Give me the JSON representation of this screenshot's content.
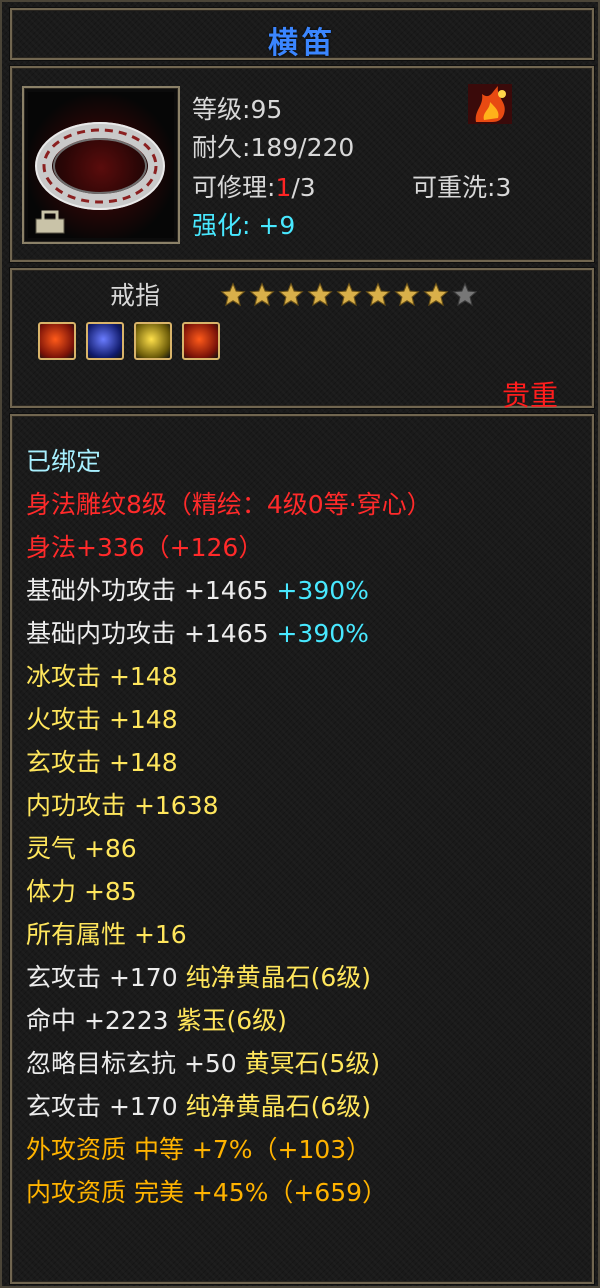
{
  "item": {
    "name": "横笛",
    "level_label": "等级:",
    "level": "95",
    "durability_label": "耐久:",
    "durability": "189/220",
    "repair_label": "可修理:",
    "repair_used": "1",
    "repair_total": "/3",
    "rewash_label": "可重洗:",
    "rewash": "3",
    "enhance_label": "强化:",
    "enhance": " +9",
    "type": "戒指",
    "stars_total": 9,
    "stars_filled": 8,
    "rarity": "贵重"
  },
  "gems": [
    "red-gem-icon",
    "blue-gem-icon",
    "yellow-gem-icon",
    "red-gem-icon"
  ],
  "attributes": [
    {
      "text": "已绑定",
      "color": "bound"
    },
    {
      "text": "身法雕纹8级（精绘：4级0等·穿心）",
      "color": "red"
    },
    {
      "text": "身法+336（+126）",
      "color": "red"
    },
    {
      "text": "基础外功攻击 +1465 ",
      "extra": "+390%",
      "color": "white"
    },
    {
      "text": "基础内功攻击 +1465 ",
      "extra": "+390%",
      "color": "white"
    },
    {
      "text": "冰攻击 +148",
      "color": "yellow"
    },
    {
      "text": "火攻击 +148",
      "color": "yellow"
    },
    {
      "text": "玄攻击 +148",
      "color": "yellow"
    },
    {
      "text": "内功攻击 +1638",
      "color": "yellow"
    },
    {
      "text": "灵气 +86",
      "color": "yellow"
    },
    {
      "text": "体力 +85",
      "color": "yellow"
    },
    {
      "text": "所有属性 +16",
      "color": "yellow"
    },
    {
      "text": "玄攻击 +170 ",
      "extra": "纯净黄晶石(6级)",
      "color": "white",
      "extra_color": "yellow"
    },
    {
      "text": "命中 +2223 ",
      "extra": "紫玉(6级)",
      "color": "white",
      "extra_color": "yellow"
    },
    {
      "text": "忽略目标玄抗 +50 ",
      "extra": "黄冥石(5级)",
      "color": "white",
      "extra_color": "yellow"
    },
    {
      "text": "玄攻击 +170 ",
      "extra": "纯净黄晶石(6级)",
      "color": "white",
      "extra_color": "yellow"
    },
    {
      "text": "外攻资质  中等 +7%（+103）",
      "color": "gold"
    },
    {
      "text": "内攻资质  完美 +45%（+659）",
      "color": "gold"
    }
  ],
  "colors": {
    "title": "#3b86ff",
    "red": "#ff2a2a",
    "cyan": "#48e8ff",
    "yellow": "#ffe65c",
    "gold": "#ffb300",
    "star_gold": "#d9b04a",
    "star_empty": "#777777"
  }
}
